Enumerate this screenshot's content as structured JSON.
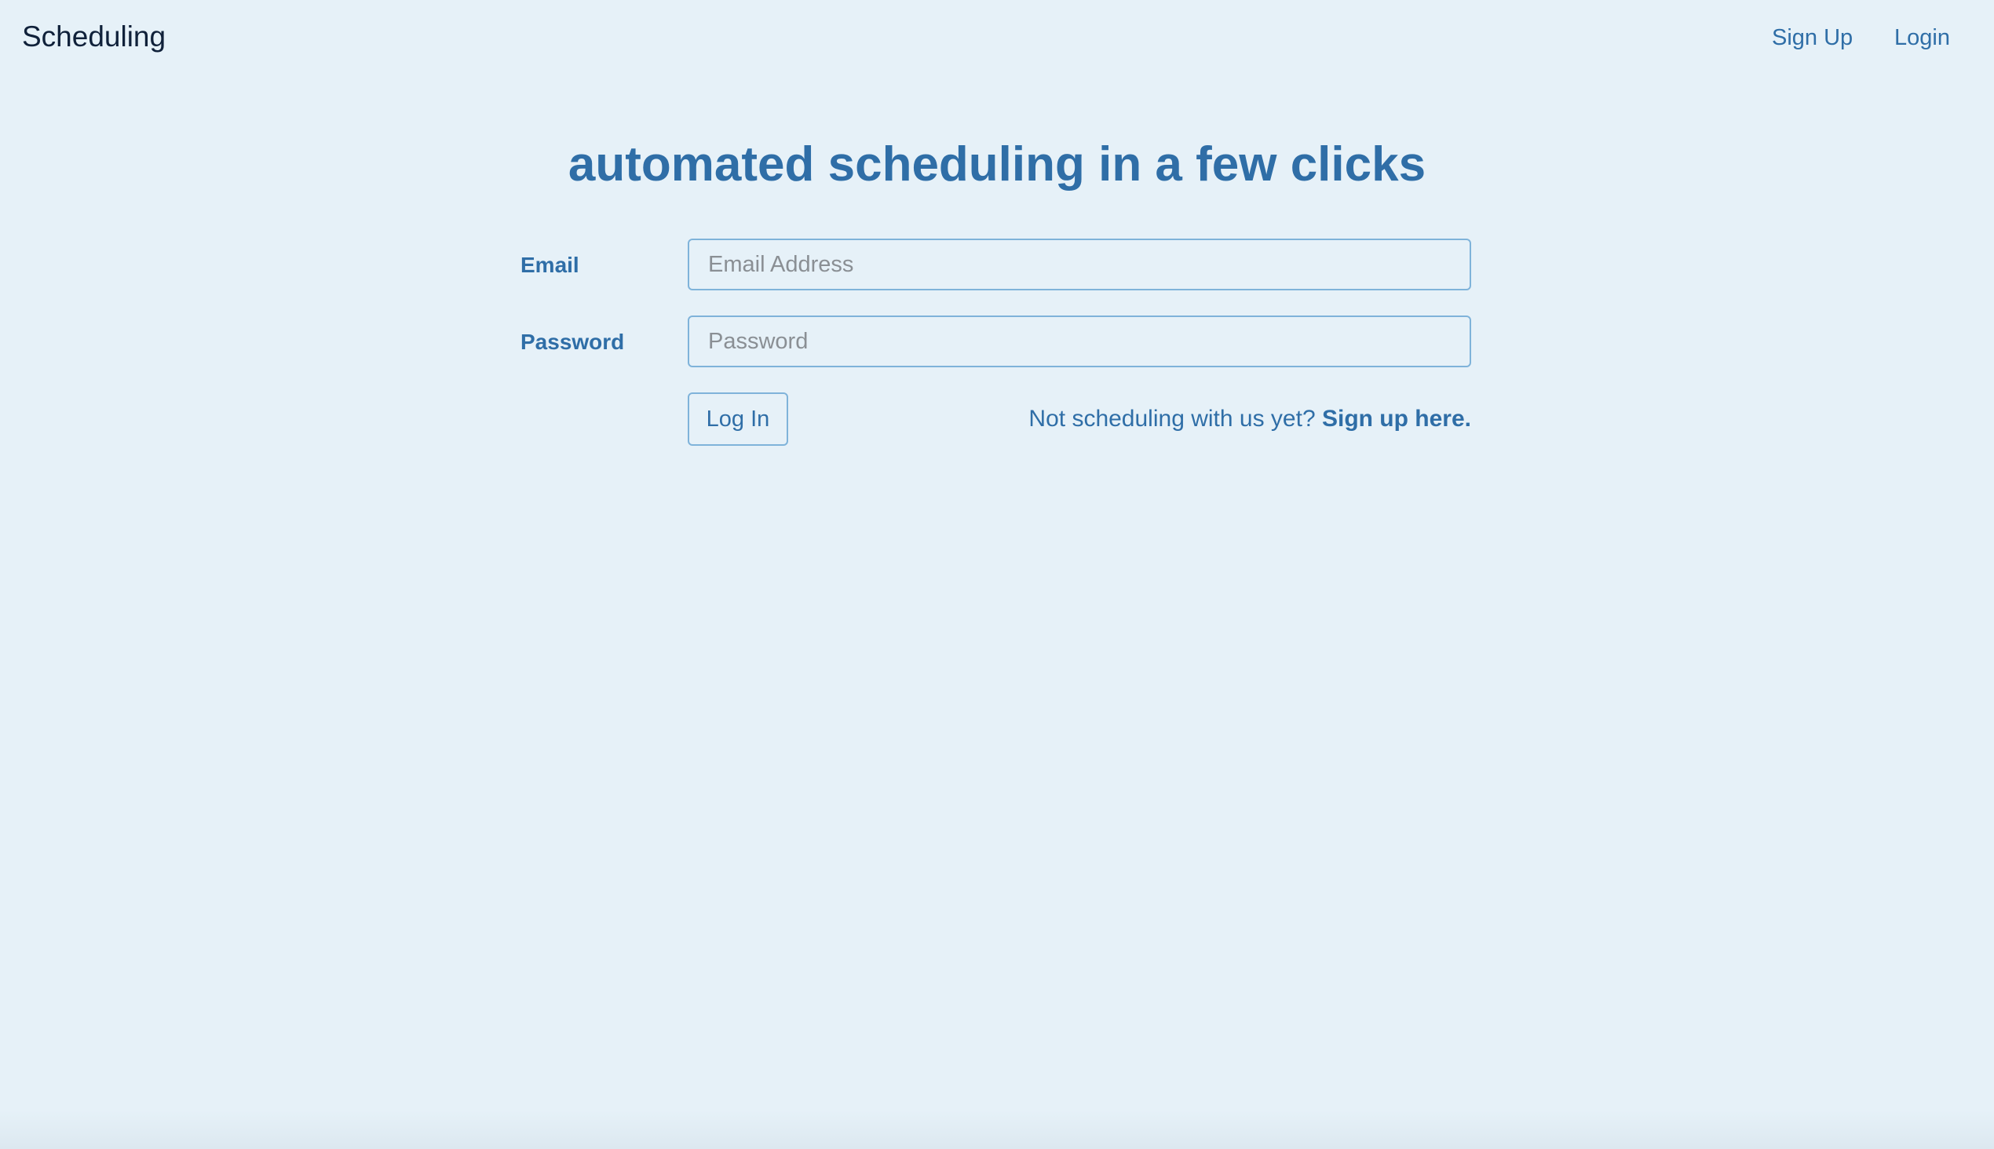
{
  "navbar": {
    "brand": "Scheduling",
    "links": [
      {
        "label": "Sign Up"
      },
      {
        "label": "Login"
      }
    ]
  },
  "main": {
    "headline": "automated scheduling in a few clicks",
    "form": {
      "email": {
        "label": "Email",
        "placeholder": "Email Address",
        "value": ""
      },
      "password": {
        "label": "Password",
        "placeholder": "Password",
        "value": ""
      },
      "submit_label": "Log In",
      "signup_prompt": "Not scheduling with us yet?",
      "signup_link": "Sign up here."
    }
  },
  "colors": {
    "background": "#e6f1f8",
    "accent": "#2f6ea7",
    "brand_text": "#10213a",
    "input_border": "#7fb3da"
  }
}
